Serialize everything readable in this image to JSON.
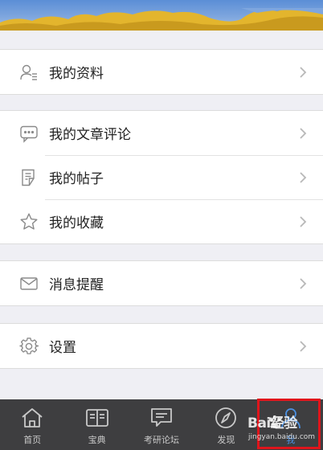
{
  "menu": {
    "profile": "我的资料",
    "comments": "我的文章评论",
    "posts": "我的帖子",
    "favorites": "我的收藏",
    "notifications": "消息提醒",
    "settings": "设置"
  },
  "tabbar": {
    "home": "首页",
    "treasure": "宝典",
    "forum": "考研论坛",
    "discover": "发现",
    "me": "我"
  },
  "watermark": {
    "main": "Bai经验",
    "sub": "jingyan.baidu.com"
  },
  "colors": {
    "accent": "#4a90e2",
    "highlight": "#e0141b",
    "tabbar_bg": "#3e3e40"
  }
}
